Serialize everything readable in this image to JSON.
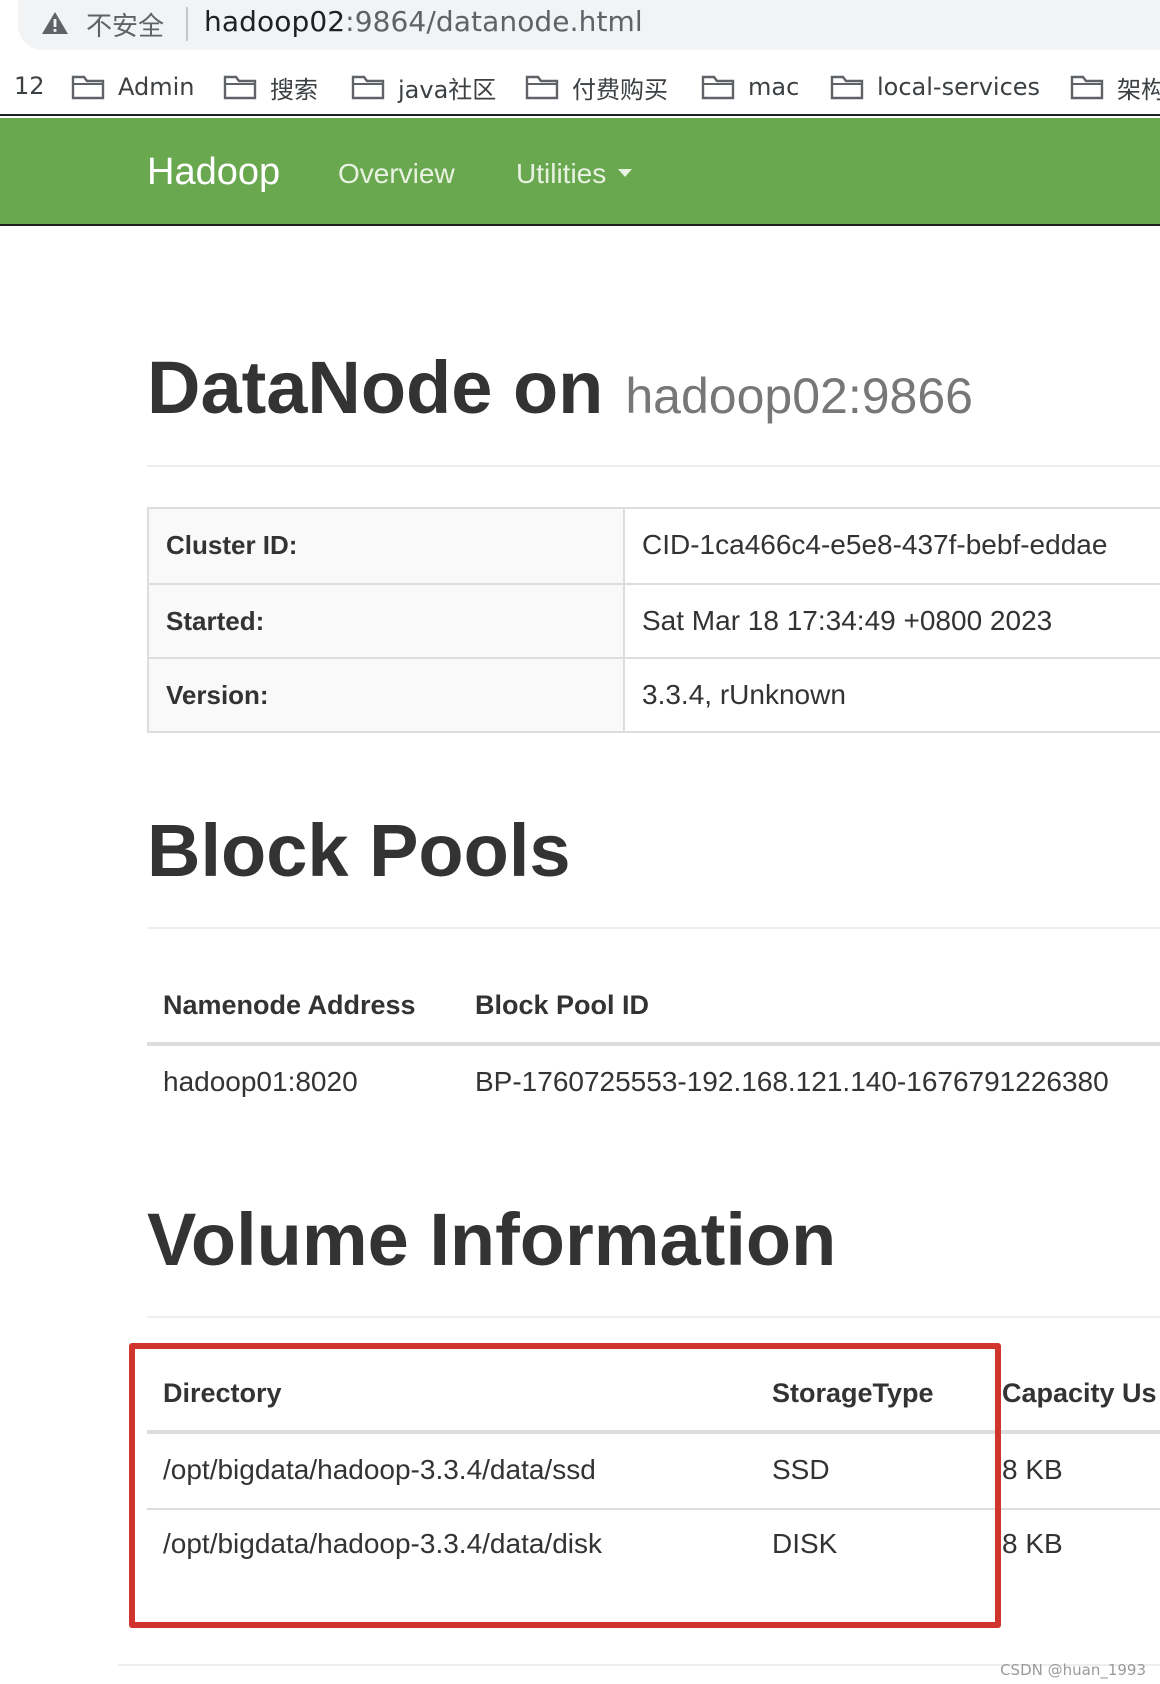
{
  "browser": {
    "security_label": "不安全",
    "url_host": "hadoop02",
    "url_rest": ":9864/datanode.html",
    "bookmarks_lead": "12",
    "bookmarks": [
      {
        "label": "Admin"
      },
      {
        "label": "搜索"
      },
      {
        "label": "java社区"
      },
      {
        "label": "付费购买"
      },
      {
        "label": "mac"
      },
      {
        "label": "local-services"
      },
      {
        "label": "架构"
      }
    ]
  },
  "navbar": {
    "brand": "Hadoop",
    "overview": "Overview",
    "utilities": "Utilities",
    "color": "#6aa84f"
  },
  "header": {
    "title": "DataNode on",
    "host": "hadoop02:9866"
  },
  "info": [
    {
      "key": "Cluster ID:",
      "value": "CID-1ca466c4-e5e8-437f-bebf-eddae"
    },
    {
      "key": "Started:",
      "value": "Sat Mar 18 17:34:49 +0800 2023"
    },
    {
      "key": "Version:",
      "value": "3.3.4, rUnknown"
    }
  ],
  "block_pools": {
    "title": "Block Pools",
    "columns": [
      "Namenode Address",
      "Block Pool ID"
    ],
    "rows": [
      [
        "hadoop01:8020",
        "BP-1760725553-192.168.121.140-1676791226380"
      ]
    ]
  },
  "volumes": {
    "title": "Volume Information",
    "columns": [
      "Directory",
      "StorageType",
      "Capacity Us"
    ],
    "rows": [
      [
        "/opt/bigdata/hadoop-3.3.4/data/ssd",
        "SSD",
        "8 KB"
      ],
      [
        "/opt/bigdata/hadoop-3.3.4/data/disk",
        "DISK",
        "8 KB"
      ]
    ],
    "highlight_color": "#d0342c"
  },
  "watermark": "CSDN @huan_1993"
}
